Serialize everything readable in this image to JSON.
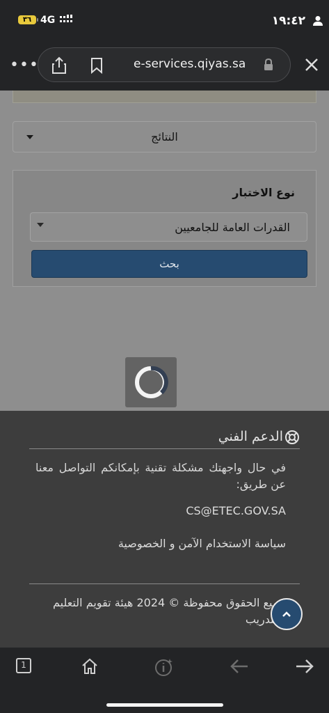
{
  "status_bar": {
    "time": "١٩:٤٢",
    "network": "4G",
    "battery": "٣٦",
    "person_icon": "person-icon",
    "signal_icon": "signal-bars-icon"
  },
  "browser": {
    "url": "e-services.qiyas.sa",
    "more_icon": "more-dots-icon",
    "share_icon": "share-icon",
    "bookmark_icon": "bookmark-icon",
    "lock_icon": "lock-icon",
    "close_icon": "close-icon"
  },
  "filters": {
    "results_select": "النتائج",
    "test_type_label": "نوع الاختبار",
    "test_type_value": "القدرات العامة للجامعيين",
    "search_button": "بحث"
  },
  "footer": {
    "support_title": "الدعم الفني",
    "support_text": "في حال واجهتك مشكلة تقنية بإمكانكم التواصل معنا عن طريق:",
    "support_email": "CS@ETEC.GOV.SA",
    "policy_link": "سياسة الاستخدام الآمن و الخصوصية",
    "copyright": "جميع الحقوق محفوظة © 2024 هيئة تقويم التعليم والتدريب"
  },
  "toolbar": {
    "tabs_count": "1",
    "items": [
      "tabs-icon",
      "home-icon",
      "page-info-icon",
      "back-arrow-icon",
      "forward-arrow-icon"
    ]
  },
  "colors": {
    "primary_button": "#264b70",
    "footer_bg": "#3d3d3d",
    "page_bg": "#8e8e8e",
    "chrome_bg": "#232426"
  }
}
